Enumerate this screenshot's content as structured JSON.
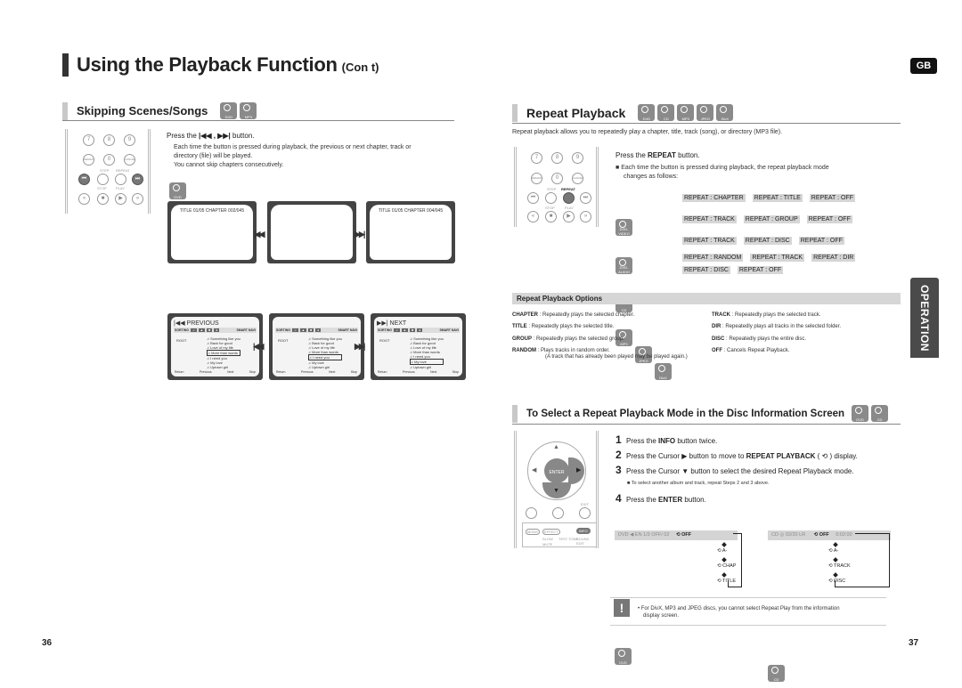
{
  "page": {
    "title": "Using the Playback Function",
    "title_suffix": "(Con t)",
    "lang_badge": "GB",
    "side_tab": "OPERATION",
    "page_left": "36",
    "page_right": "37"
  },
  "skipping": {
    "heading": "Skipping Scenes/Songs",
    "discs": [
      "DVD",
      "MP3"
    ],
    "instruction_prefix": "Press the",
    "instruction_glyphs": "|◀◀ , ▶▶|",
    "instruction_suffix": "button.",
    "desc_line1": "Each time the button is pressed during playback, the previous or next chapter, track or",
    "desc_line2": "directory (file) will be played.",
    "desc_line3": "You cannot skip chapters consecutively.",
    "remote": {
      "keys": [
        "7",
        "8",
        "9",
        "REMAIN",
        "0",
        "CANCEL"
      ],
      "labels": [
        "STEP",
        "REPEAT",
        "STOP",
        "PLAY"
      ]
    },
    "dvd_label": "DVD",
    "dvd_screens": [
      {
        "text": "TITLE 01/05 CHAPTER 002/045"
      },
      {
        "text": ""
      },
      {
        "text": "TITLE 01/05 CHAPTER 004/045"
      }
    ],
    "prev_glyph": "|◀◀",
    "next_glyph": "▶▶|",
    "mp3_label": "MP3",
    "mp3_screens": [
      {
        "header": "|◀◀ PREVIOUS",
        "selected": 3
      },
      {
        "header": "",
        "selected": 4
      },
      {
        "header": "▶▶| NEXT",
        "selected": 5
      }
    ],
    "mp3_toolbar": [
      "SORTING",
      "SMART NAVI"
    ],
    "mp3_root": "ROOT",
    "mp3_tracks": [
      "Something like you",
      "Back for good",
      "Love of my life",
      "More than words",
      "I need you",
      "My love",
      "Uptown girl"
    ],
    "mp3_footer": [
      "Return",
      "Previous",
      "Next",
      "Stop"
    ]
  },
  "repeat": {
    "heading": "Repeat Playback",
    "discs": [
      "DVD",
      "CD",
      "MP3",
      "JPEG",
      "DivX"
    ],
    "intro": "Repeat playback allows you to repeatedly play a chapter, title, track (song), or directory (MP3 file).",
    "press_prefix": "Press the ",
    "press_bold": "REPEAT",
    "press_suffix": " button.",
    "bullet_line1": "Each time the button is pressed during playback, the repeat playback mode",
    "bullet_line2": "changes as follows:",
    "remote_highlight": "REPEAT",
    "modes": [
      {
        "discs": [
          "DVD-VIDEO"
        ],
        "items": [
          "REPEAT : CHAPTER",
          "REPEAT : TITLE",
          "REPEAT : OFF"
        ]
      },
      {
        "discs": [
          "DVD-AUDIO"
        ],
        "items": [
          "REPEAT : TRACK",
          "REPEAT : GROUP",
          "REPEAT : OFF"
        ]
      },
      {
        "discs": [
          "CD"
        ],
        "items": [
          "REPEAT : TRACK",
          "REPEAT : DISC",
          "REPEAT : OFF"
        ]
      },
      {
        "discs": [
          "MP3",
          "JPEG",
          "DivX"
        ],
        "items": [
          "REPEAT : RANDOM",
          "REPEAT : TRACK",
          "REPEAT : DIR"
        ]
      },
      {
        "discs": [],
        "items": [
          "REPEAT : DISC",
          "REPEAT : OFF"
        ]
      }
    ]
  },
  "options": {
    "heading": "Repeat Playback Options",
    "left": [
      {
        "term": "CHAPTER",
        "desc": " : Repeatedly plays the selected chapter."
      },
      {
        "term": "TITLE",
        "desc": " : Repeatedly plays the selected title."
      },
      {
        "term": "GROUP",
        "desc": " : Repeatedly plays the selected group."
      },
      {
        "term": "RANDOM",
        "desc": " : Plays tracks in random order."
      }
    ],
    "random_note": "(A track that has already been played may be played again.)",
    "right": [
      {
        "term": "TRACK",
        "desc": " : Repeatedly plays the selected track."
      },
      {
        "term": "DIR",
        "desc": " : Repeatedly plays all tracks in the selected folder."
      },
      {
        "term": "DISC",
        "desc": " : Repeatedly plays the entire disc."
      },
      {
        "term": "OFF",
        "desc": " : Cancels Repeat Playback."
      }
    ]
  },
  "disc_info": {
    "heading": "To Select a Repeat Playback Mode in the Disc Information Screen",
    "discs": [
      "DVD",
      "CD"
    ],
    "steps": [
      {
        "n": "1",
        "pre": "Press the ",
        "bold": "INFO",
        "post": " button twice."
      },
      {
        "n": "2",
        "pre": "Press the Cursor ▶ button to move to ",
        "bold": "REPEAT PLAYBACK",
        "post": " ( ⟲ ) display."
      },
      {
        "n": "3",
        "pre": "Press the Cursor ▼ button to select the desired Repeat Playback mode.",
        "bold": "",
        "post": ""
      },
      {
        "n": "4",
        "pre": "Press the ",
        "bold": "ENTER",
        "post": " button."
      }
    ],
    "sub_note": "To select another album and track, repeat Steps 2 and 3 above.",
    "remote_labels": [
      "ENTER",
      "EXIT",
      "MODE",
      "EFFECT",
      "INFO",
      "SLOW",
      "TEST TONE",
      "SOUND EDIT",
      "MUTE",
      "DIMMER"
    ],
    "dvd_bar": "DVD  ◀  EN 1/3   OFF/ 02",
    "dvd_bar_active": "⟲ OFF",
    "dvd_modes": [
      "⟲ A-",
      "⟲ CHAP",
      "⟲ TITLE"
    ],
    "cd_bar": "CD   ◎ 02/20   LR",
    "cd_bar_active": "⟲ OFF",
    "cd_bar_tail": "0:02:00",
    "cd_modes": [
      "⟲ A-",
      "⟲ TRACK",
      "⟲ DISC"
    ],
    "disc_labels": [
      "DVD",
      "CD"
    ]
  },
  "note": {
    "icon": "!",
    "text_line1": "• For DivX, MP3 and JPEG discs, you cannot select Repeat Play from the information",
    "text_line2": "display screen."
  }
}
